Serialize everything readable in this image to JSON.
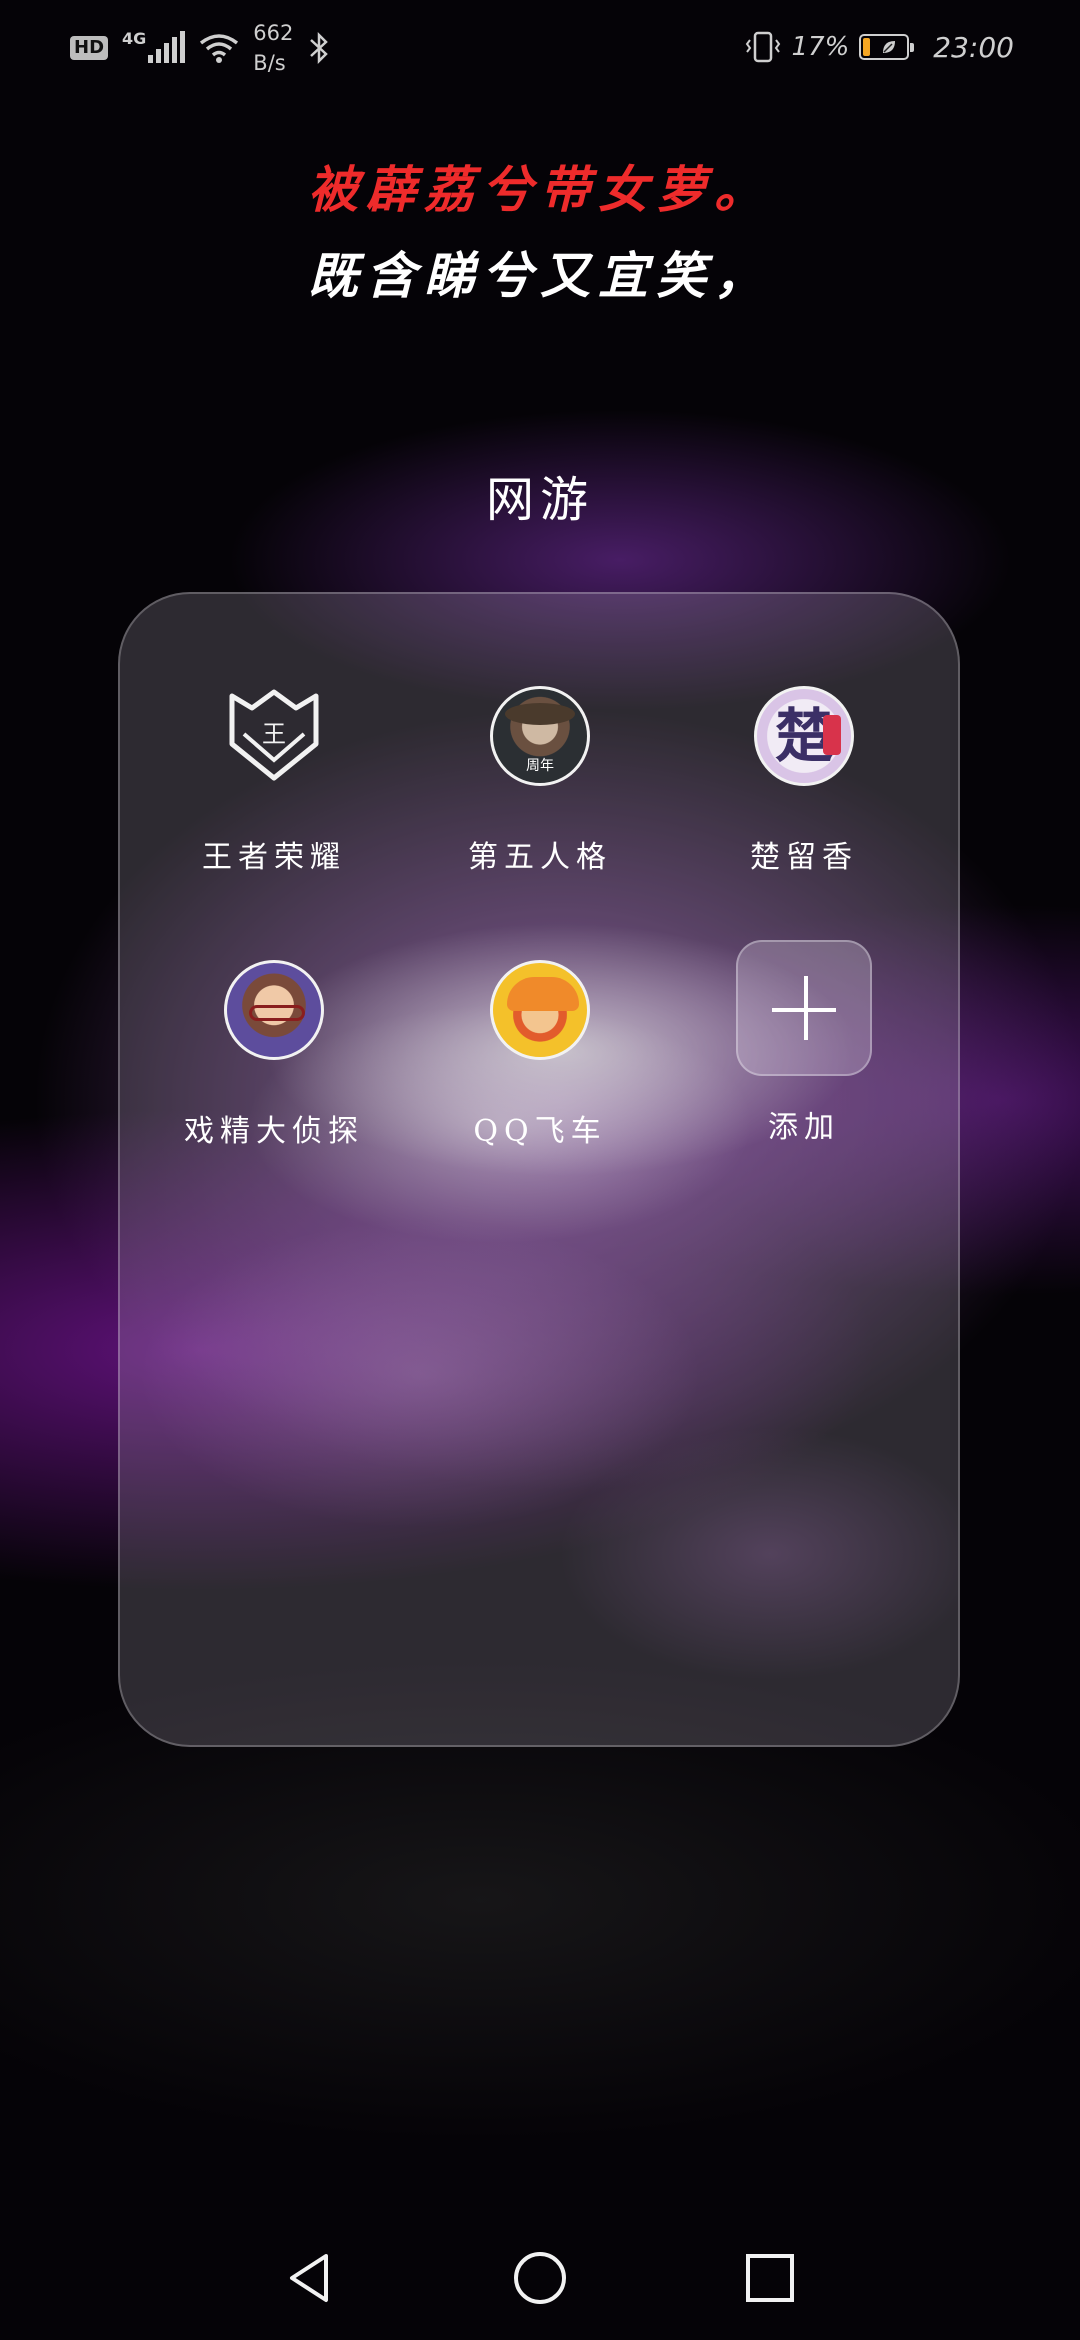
{
  "status_bar": {
    "hd": "HD",
    "network_type": "4G",
    "net_speed_value": "662",
    "net_speed_unit": "B/s",
    "battery_percent": "17%",
    "battery_level": 0.17,
    "time": "23:00",
    "icons": [
      "hd-icon",
      "signal-icon",
      "wifi-icon",
      "bluetooth-icon",
      "vibrate-icon",
      "battery-icon"
    ]
  },
  "wallpaper_text": {
    "line1": "被薜荔兮带女萝。",
    "line2": "既含睇兮又宜笑，",
    "line1_color": "#ee2b2b",
    "line2_color": "#ffffff"
  },
  "folder": {
    "title": "网游",
    "apps": [
      {
        "label": "王者荣耀",
        "icon": "honor-of-kings-icon"
      },
      {
        "label": "第五人格",
        "icon": "identity-v-icon",
        "badge": "周年"
      },
      {
        "label": "楚留香",
        "icon": "chu-liu-xiang-icon",
        "glyph": "楚"
      },
      {
        "label": "戏精大侦探",
        "icon": "detective-game-icon"
      },
      {
        "label": "QQ飞车",
        "icon": "qq-speed-icon"
      }
    ],
    "add_label": "添加"
  },
  "nav_bar": {
    "buttons": [
      "back-icon",
      "home-icon",
      "recents-icon"
    ]
  }
}
